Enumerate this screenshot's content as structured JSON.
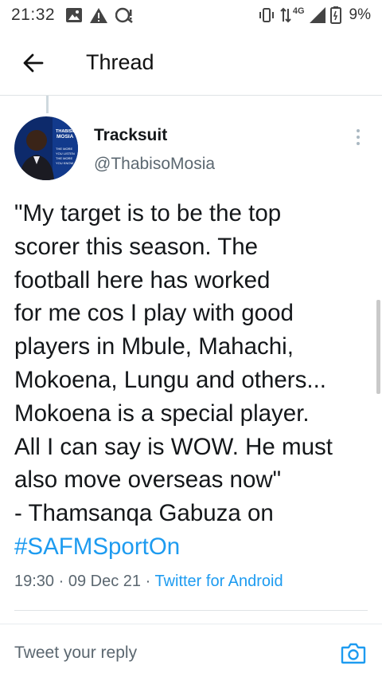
{
  "status_bar": {
    "time": "21:32",
    "network_label": "4G",
    "battery_pct": "9%",
    "icons": [
      "gallery-icon",
      "warning-icon",
      "notification-icon",
      "vibrate-icon",
      "data-transfer-icon",
      "signal-icon",
      "battery-icon"
    ]
  },
  "header": {
    "title": "Thread",
    "back_icon": "arrow-left-icon"
  },
  "tweet": {
    "author_name": "Tracksuit",
    "author_handle": "@ThabisoMosia",
    "avatar_text": [
      "THABISO",
      "MOSIA",
      "THE MORE",
      "YOU LISTEN",
      "THE MORE",
      "YOU KNOW"
    ],
    "body_lines": [
      "\"My target is to be the top",
      "scorer this season. The",
      "football here has worked",
      "for me cos I play with good",
      "players in Mbule, Mahachi,",
      "Mokoena, Lungu and others...",
      "Mokoena is a special player.",
      "All I can say is WOW. He must",
      "also move overseas now\"",
      "- Thamsanqa Gabuza on"
    ],
    "hashtag": "#SAFMSportOn",
    "time": "19:30",
    "date": "09 Dec 21",
    "source": "Twitter for Android",
    "separator": "·"
  },
  "reply": {
    "placeholder": "Tweet your reply",
    "camera_icon": "camera-icon"
  },
  "colors": {
    "accent": "#1d9bf0",
    "secondary_text": "#5b6770",
    "divider": "#dfe3e6"
  }
}
